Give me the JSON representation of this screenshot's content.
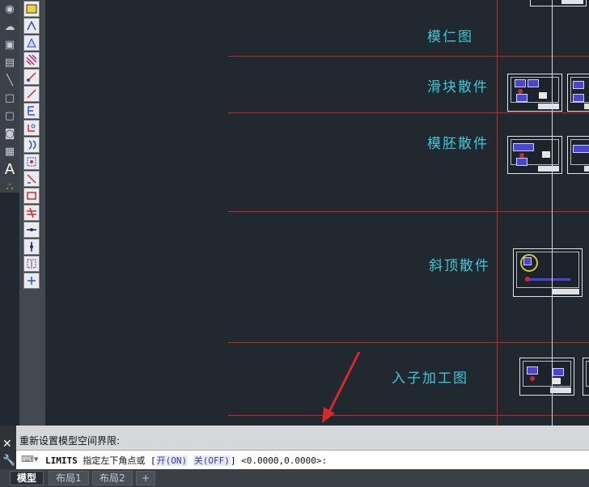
{
  "drawing": {
    "sections": [
      {
        "label": "模仁图"
      },
      {
        "label": "滑块散件"
      },
      {
        "label": "模胚散件"
      },
      {
        "label": "斜顶散件"
      },
      {
        "label": "入子加工图"
      }
    ]
  },
  "command_line": {
    "history": "重新设置模型空间界限:",
    "command_name": "LIMITS",
    "prompt_text": "指定左下角点或",
    "option_open_bracket": "[",
    "option_on_label": "开(ON)",
    "option_off_label": "关(OFF)",
    "option_close_bracket": "]",
    "default_value": "<0.0000,0.0000>:"
  },
  "tabs": {
    "model": "模型",
    "layout1": "布局1",
    "layout2": "布局2",
    "add": "+"
  },
  "icons": {
    "close": "close-icon",
    "customize": "wrench-icon",
    "prompt": "command-prompt-icon",
    "draw_toolbar": [
      "circle-icon",
      "cloud-icon",
      "block-icon",
      "insert-icon",
      "line-icon",
      "rectangle-icon",
      "rectangle-icon",
      "camera-icon",
      "table-icon",
      "text-icon",
      "points-icon"
    ],
    "dim_toolbar": [
      "linear-dim-icon",
      "aligned-dim-icon",
      "angular-dim-icon",
      "hatch-icon",
      "radius-dim-icon",
      "diameter-dim-icon",
      "ordinate-dim-icon",
      "arc-dim-icon",
      "continue-dim-icon",
      "baseline-dim-icon",
      "break-dim-icon",
      "tolerance-dim-icon",
      "center-mark-icon",
      "jog-dim-icon",
      "space-dim-icon",
      "edit-dim-icon",
      "update-dim-icon"
    ]
  },
  "colors": {
    "canvas": "#212830",
    "frame_line": "#c5262a",
    "label_text": "#3ec7d6",
    "crosshair": "#d7d7d7"
  }
}
